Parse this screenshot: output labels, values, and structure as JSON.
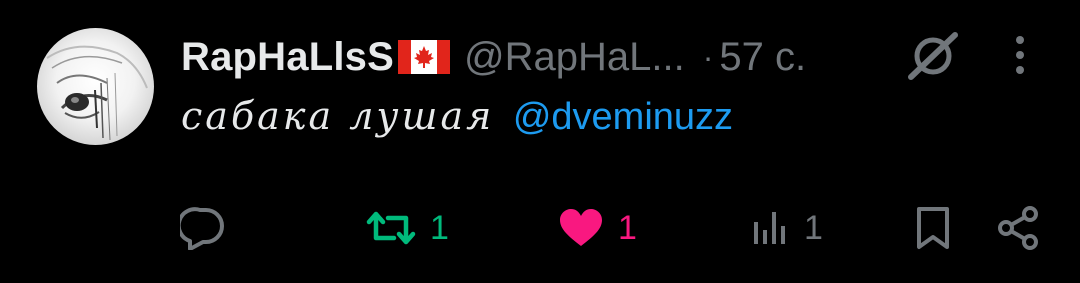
{
  "tweet": {
    "display_name": "RapHaLlsS",
    "flag": "canada-flag",
    "handle": "@RapHaL...",
    "separator": "·",
    "time": "57 с.",
    "text": "сабака лушая",
    "mention": "@dveminuzz"
  },
  "actions": {
    "reply_icon": "reply-icon",
    "retweets": "1",
    "likes": "1",
    "views": "1"
  },
  "colors": {
    "background": "#000000",
    "text": "#e7e9ea",
    "muted": "#71767b",
    "link": "#1d9bf0",
    "retweet_active": "#00ba7c",
    "like_active": "#f91880"
  },
  "state": {
    "liked": true,
    "retweeted": true
  }
}
